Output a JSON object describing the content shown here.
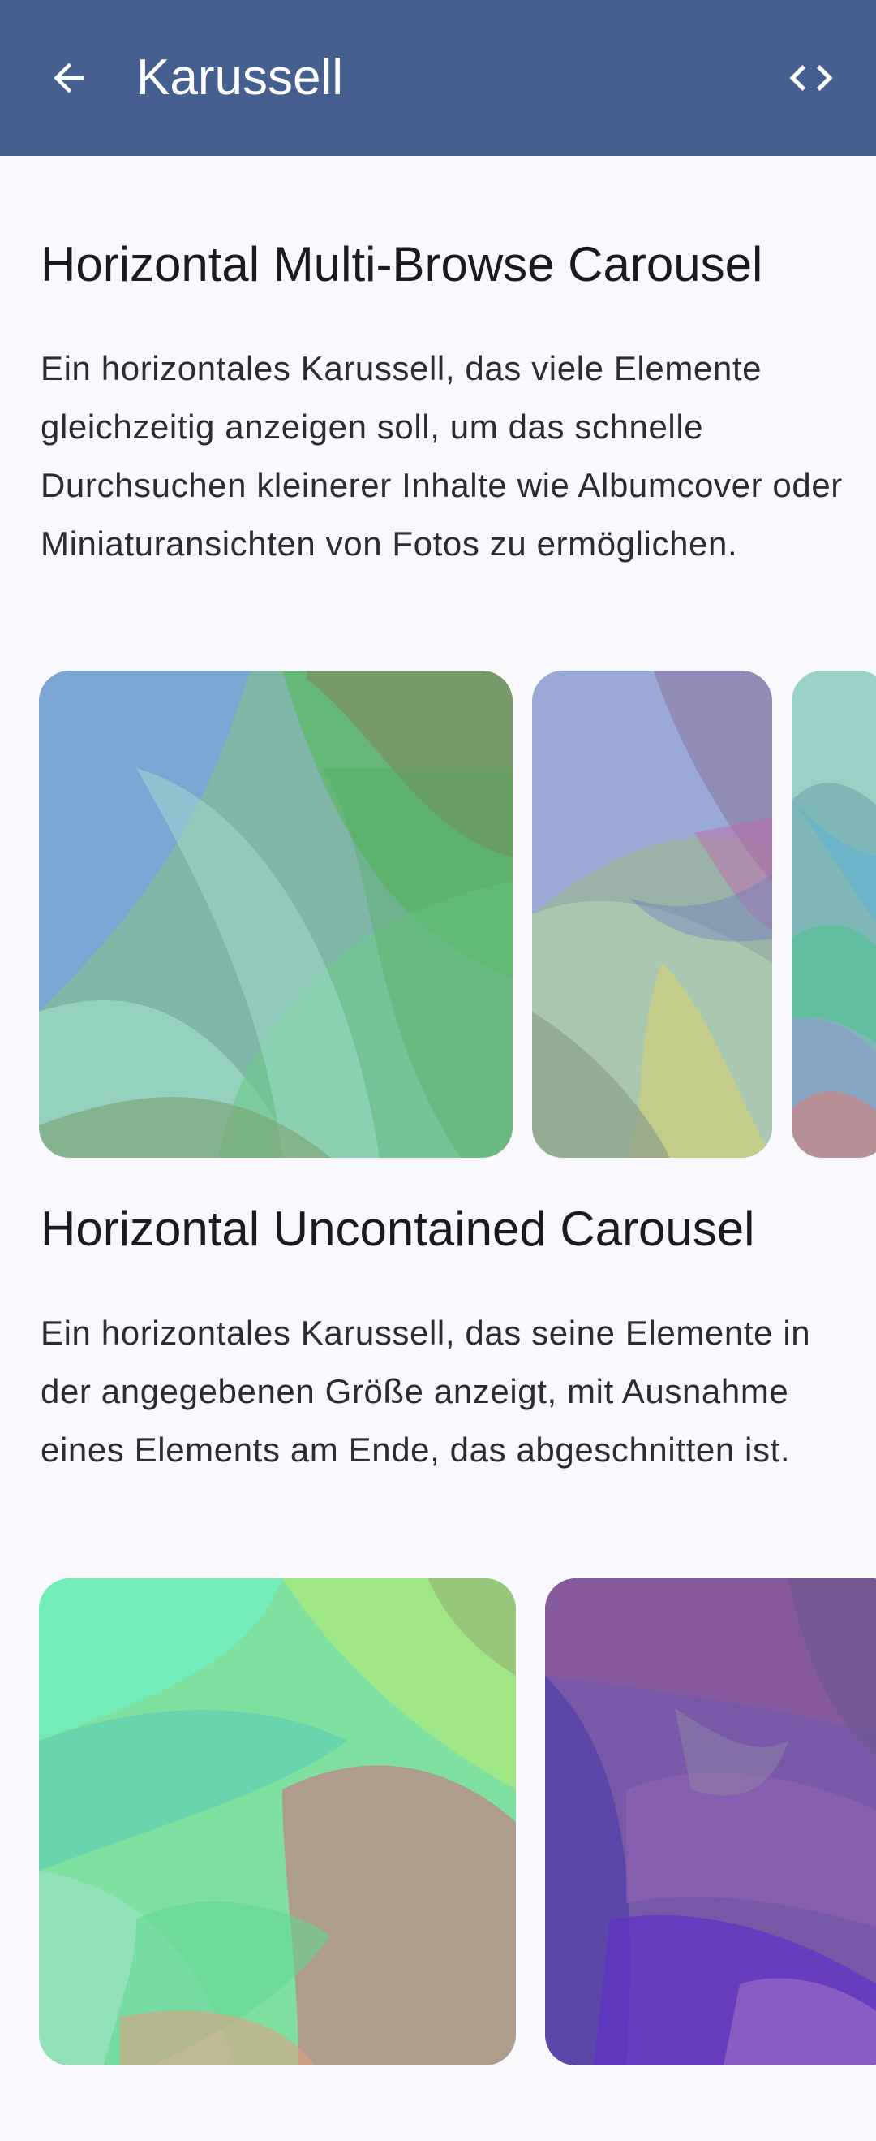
{
  "app_bar": {
    "title": "Karussell",
    "back_icon": "arrow-back-icon",
    "code_icon": "code-brackets-icon"
  },
  "sections": [
    {
      "title": "Horizontal Multi-Browse Carousel",
      "description": "Ein horizontales Karussell, das viele Elemente gleichzeitig anzeigen soll, um das schnelle Durchsuchen kleinerer Inhalte wie Albumcover oder Miniaturansichten von Fotos zu ermöglichen."
    },
    {
      "title": "Horizontal Uncontained Carousel",
      "description": "Ein horizontales Karussell, das seine Elemente in der angegebenen Größe anzeigt, mit Ausnahme eines Elements am Ende, das abgeschnitten ist."
    }
  ],
  "colors": {
    "app_bar": "#455f8f",
    "background": "#f9f8fd"
  }
}
